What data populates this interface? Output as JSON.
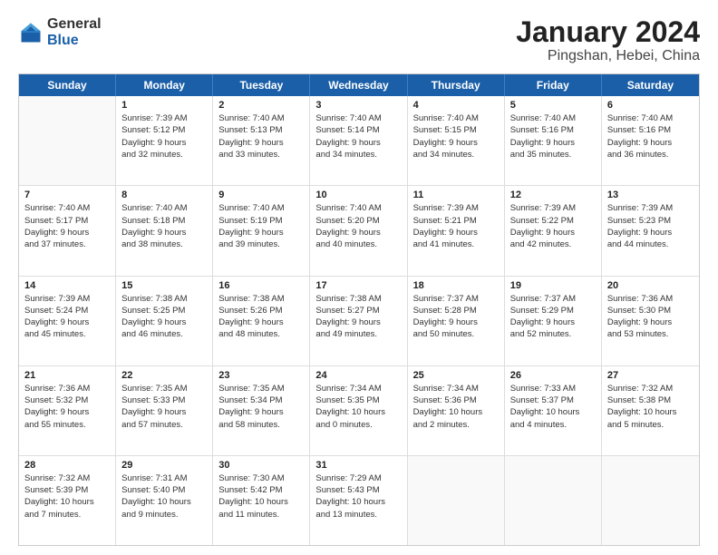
{
  "header": {
    "logo_general": "General",
    "logo_blue": "Blue",
    "title": "January 2024",
    "subtitle": "Pingshan, Hebei, China"
  },
  "weekdays": [
    "Sunday",
    "Monday",
    "Tuesday",
    "Wednesday",
    "Thursday",
    "Friday",
    "Saturday"
  ],
  "rows": [
    [
      {
        "day": "",
        "lines": []
      },
      {
        "day": "1",
        "lines": [
          "Sunrise: 7:39 AM",
          "Sunset: 5:12 PM",
          "Daylight: 9 hours",
          "and 32 minutes."
        ]
      },
      {
        "day": "2",
        "lines": [
          "Sunrise: 7:40 AM",
          "Sunset: 5:13 PM",
          "Daylight: 9 hours",
          "and 33 minutes."
        ]
      },
      {
        "day": "3",
        "lines": [
          "Sunrise: 7:40 AM",
          "Sunset: 5:14 PM",
          "Daylight: 9 hours",
          "and 34 minutes."
        ]
      },
      {
        "day": "4",
        "lines": [
          "Sunrise: 7:40 AM",
          "Sunset: 5:15 PM",
          "Daylight: 9 hours",
          "and 34 minutes."
        ]
      },
      {
        "day": "5",
        "lines": [
          "Sunrise: 7:40 AM",
          "Sunset: 5:16 PM",
          "Daylight: 9 hours",
          "and 35 minutes."
        ]
      },
      {
        "day": "6",
        "lines": [
          "Sunrise: 7:40 AM",
          "Sunset: 5:16 PM",
          "Daylight: 9 hours",
          "and 36 minutes."
        ]
      }
    ],
    [
      {
        "day": "7",
        "lines": [
          "Sunrise: 7:40 AM",
          "Sunset: 5:17 PM",
          "Daylight: 9 hours",
          "and 37 minutes."
        ]
      },
      {
        "day": "8",
        "lines": [
          "Sunrise: 7:40 AM",
          "Sunset: 5:18 PM",
          "Daylight: 9 hours",
          "and 38 minutes."
        ]
      },
      {
        "day": "9",
        "lines": [
          "Sunrise: 7:40 AM",
          "Sunset: 5:19 PM",
          "Daylight: 9 hours",
          "and 39 minutes."
        ]
      },
      {
        "day": "10",
        "lines": [
          "Sunrise: 7:40 AM",
          "Sunset: 5:20 PM",
          "Daylight: 9 hours",
          "and 40 minutes."
        ]
      },
      {
        "day": "11",
        "lines": [
          "Sunrise: 7:39 AM",
          "Sunset: 5:21 PM",
          "Daylight: 9 hours",
          "and 41 minutes."
        ]
      },
      {
        "day": "12",
        "lines": [
          "Sunrise: 7:39 AM",
          "Sunset: 5:22 PM",
          "Daylight: 9 hours",
          "and 42 minutes."
        ]
      },
      {
        "day": "13",
        "lines": [
          "Sunrise: 7:39 AM",
          "Sunset: 5:23 PM",
          "Daylight: 9 hours",
          "and 44 minutes."
        ]
      }
    ],
    [
      {
        "day": "14",
        "lines": [
          "Sunrise: 7:39 AM",
          "Sunset: 5:24 PM",
          "Daylight: 9 hours",
          "and 45 minutes."
        ]
      },
      {
        "day": "15",
        "lines": [
          "Sunrise: 7:38 AM",
          "Sunset: 5:25 PM",
          "Daylight: 9 hours",
          "and 46 minutes."
        ]
      },
      {
        "day": "16",
        "lines": [
          "Sunrise: 7:38 AM",
          "Sunset: 5:26 PM",
          "Daylight: 9 hours",
          "and 48 minutes."
        ]
      },
      {
        "day": "17",
        "lines": [
          "Sunrise: 7:38 AM",
          "Sunset: 5:27 PM",
          "Daylight: 9 hours",
          "and 49 minutes."
        ]
      },
      {
        "day": "18",
        "lines": [
          "Sunrise: 7:37 AM",
          "Sunset: 5:28 PM",
          "Daylight: 9 hours",
          "and 50 minutes."
        ]
      },
      {
        "day": "19",
        "lines": [
          "Sunrise: 7:37 AM",
          "Sunset: 5:29 PM",
          "Daylight: 9 hours",
          "and 52 minutes."
        ]
      },
      {
        "day": "20",
        "lines": [
          "Sunrise: 7:36 AM",
          "Sunset: 5:30 PM",
          "Daylight: 9 hours",
          "and 53 minutes."
        ]
      }
    ],
    [
      {
        "day": "21",
        "lines": [
          "Sunrise: 7:36 AM",
          "Sunset: 5:32 PM",
          "Daylight: 9 hours",
          "and 55 minutes."
        ]
      },
      {
        "day": "22",
        "lines": [
          "Sunrise: 7:35 AM",
          "Sunset: 5:33 PM",
          "Daylight: 9 hours",
          "and 57 minutes."
        ]
      },
      {
        "day": "23",
        "lines": [
          "Sunrise: 7:35 AM",
          "Sunset: 5:34 PM",
          "Daylight: 9 hours",
          "and 58 minutes."
        ]
      },
      {
        "day": "24",
        "lines": [
          "Sunrise: 7:34 AM",
          "Sunset: 5:35 PM",
          "Daylight: 10 hours",
          "and 0 minutes."
        ]
      },
      {
        "day": "25",
        "lines": [
          "Sunrise: 7:34 AM",
          "Sunset: 5:36 PM",
          "Daylight: 10 hours",
          "and 2 minutes."
        ]
      },
      {
        "day": "26",
        "lines": [
          "Sunrise: 7:33 AM",
          "Sunset: 5:37 PM",
          "Daylight: 10 hours",
          "and 4 minutes."
        ]
      },
      {
        "day": "27",
        "lines": [
          "Sunrise: 7:32 AM",
          "Sunset: 5:38 PM",
          "Daylight: 10 hours",
          "and 5 minutes."
        ]
      }
    ],
    [
      {
        "day": "28",
        "lines": [
          "Sunrise: 7:32 AM",
          "Sunset: 5:39 PM",
          "Daylight: 10 hours",
          "and 7 minutes."
        ]
      },
      {
        "day": "29",
        "lines": [
          "Sunrise: 7:31 AM",
          "Sunset: 5:40 PM",
          "Daylight: 10 hours",
          "and 9 minutes."
        ]
      },
      {
        "day": "30",
        "lines": [
          "Sunrise: 7:30 AM",
          "Sunset: 5:42 PM",
          "Daylight: 10 hours",
          "and 11 minutes."
        ]
      },
      {
        "day": "31",
        "lines": [
          "Sunrise: 7:29 AM",
          "Sunset: 5:43 PM",
          "Daylight: 10 hours",
          "and 13 minutes."
        ]
      },
      {
        "day": "",
        "lines": []
      },
      {
        "day": "",
        "lines": []
      },
      {
        "day": "",
        "lines": []
      }
    ]
  ]
}
